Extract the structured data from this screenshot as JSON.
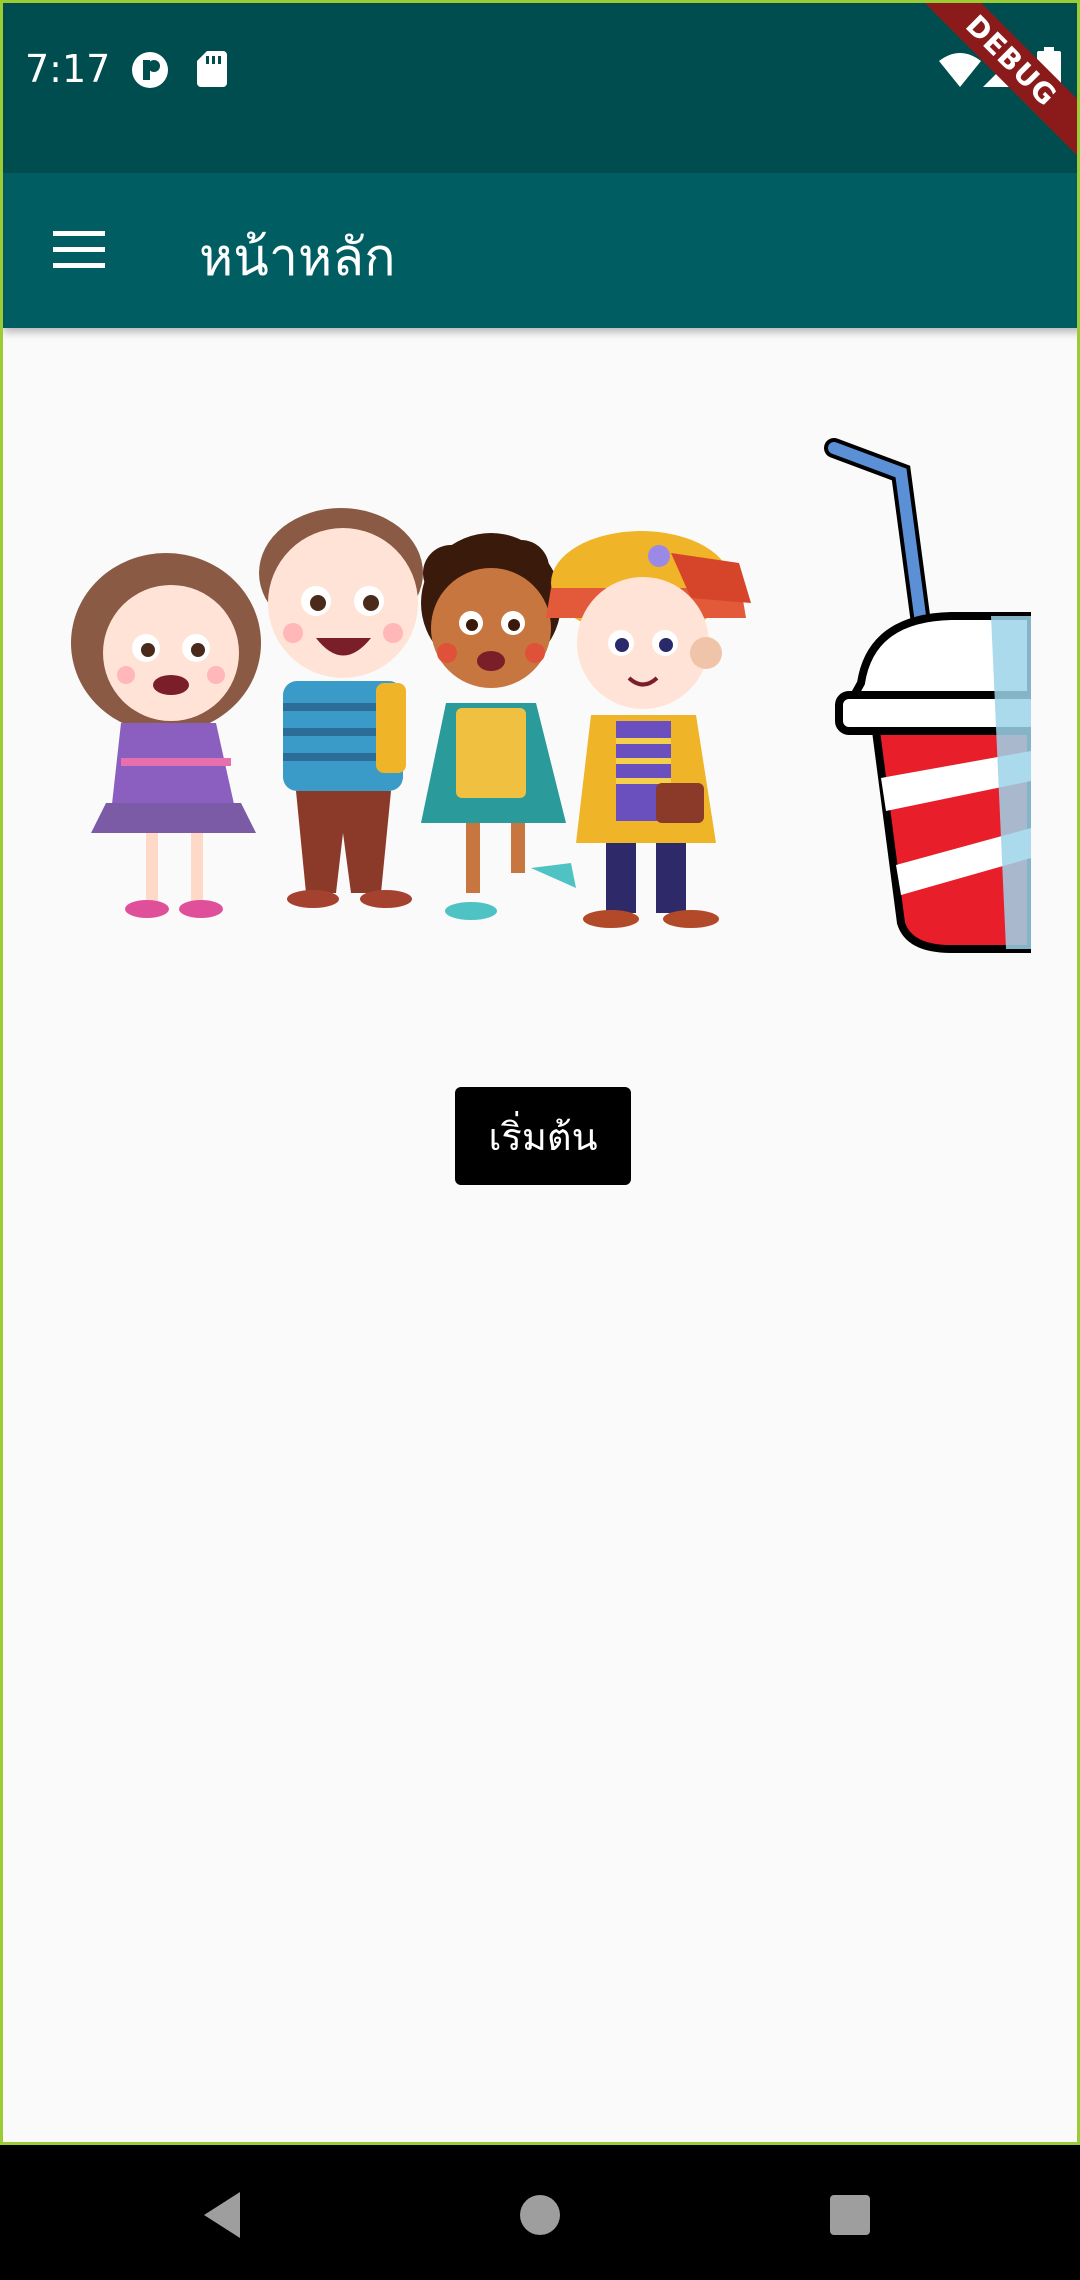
{
  "status_bar": {
    "time": "7:17",
    "icons": [
      "app-notification-icon",
      "sd-card-icon",
      "wifi-icon",
      "signal-icon",
      "battery-icon"
    ],
    "debug_banner": "DEBUG",
    "background": "#004d50"
  },
  "app_bar": {
    "menu_icon": "hamburger-menu-icon",
    "title": "หน้าหลัก",
    "background": "#005e63"
  },
  "main": {
    "illustrations": [
      "kids-group-illustration",
      "soda-cup-illustration"
    ],
    "start_button": "เริ่มต้น"
  },
  "nav_bar": {
    "icons": [
      "back-icon",
      "home-icon",
      "recents-icon"
    ]
  },
  "colors": {
    "accent": "#005e63",
    "page_background": "#fafafa",
    "button_background": "#000000"
  }
}
